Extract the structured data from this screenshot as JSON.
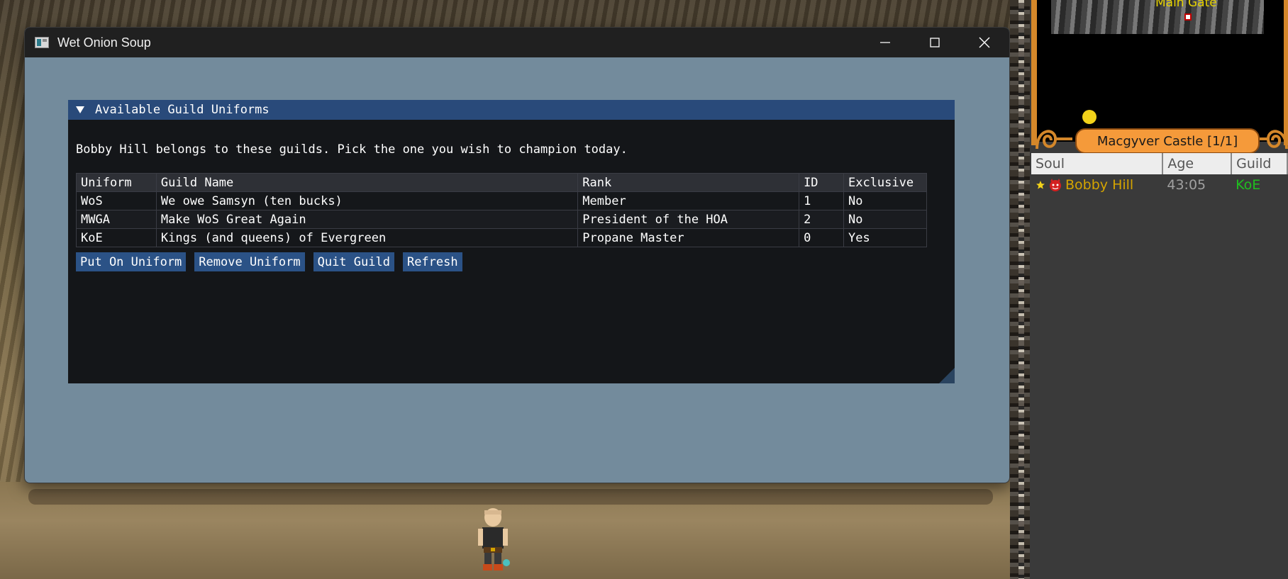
{
  "window": {
    "title": "Wet Onion Soup",
    "minimize_icon": "minimize-icon",
    "maximize_icon": "maximize-icon",
    "close_icon": "close-icon"
  },
  "panel": {
    "header": "Available Guild Uniforms",
    "intro": "Bobby Hill belongs to these guilds. Pick the one you wish to champion today.",
    "columns": [
      "Uniform",
      "Guild Name",
      "Rank",
      "ID",
      "Exclusive"
    ],
    "rows": [
      [
        "WoS",
        "We owe Samsyn (ten bucks)",
        "Member",
        "1",
        "No"
      ],
      [
        "MWGA",
        "Make WoS Great Again",
        "President of the HOA",
        "2",
        "No"
      ],
      [
        "KoE",
        "Kings (and queens) of Evergreen",
        "Propane Master",
        "0",
        "Yes"
      ]
    ],
    "buttons": {
      "put_on": "Put On Uniform",
      "remove": "Remove Uniform",
      "quit": "Quit Guild",
      "refresh": "Refresh"
    }
  },
  "game": {
    "minimap_label": "Main Gate",
    "location": "Macgyver Castle [1/1]",
    "player_columns": [
      "Soul",
      "Age",
      "Guild"
    ],
    "players": [
      {
        "soul": "Bobby Hill",
        "age": "43:05",
        "guild": "KoE"
      }
    ]
  },
  "colors": {
    "panel_header": "#294a7a",
    "button": "#2b5286",
    "window_bg": "#738b9c",
    "guild_text": "#1fbf1f",
    "soul_text": "#d4a400"
  }
}
